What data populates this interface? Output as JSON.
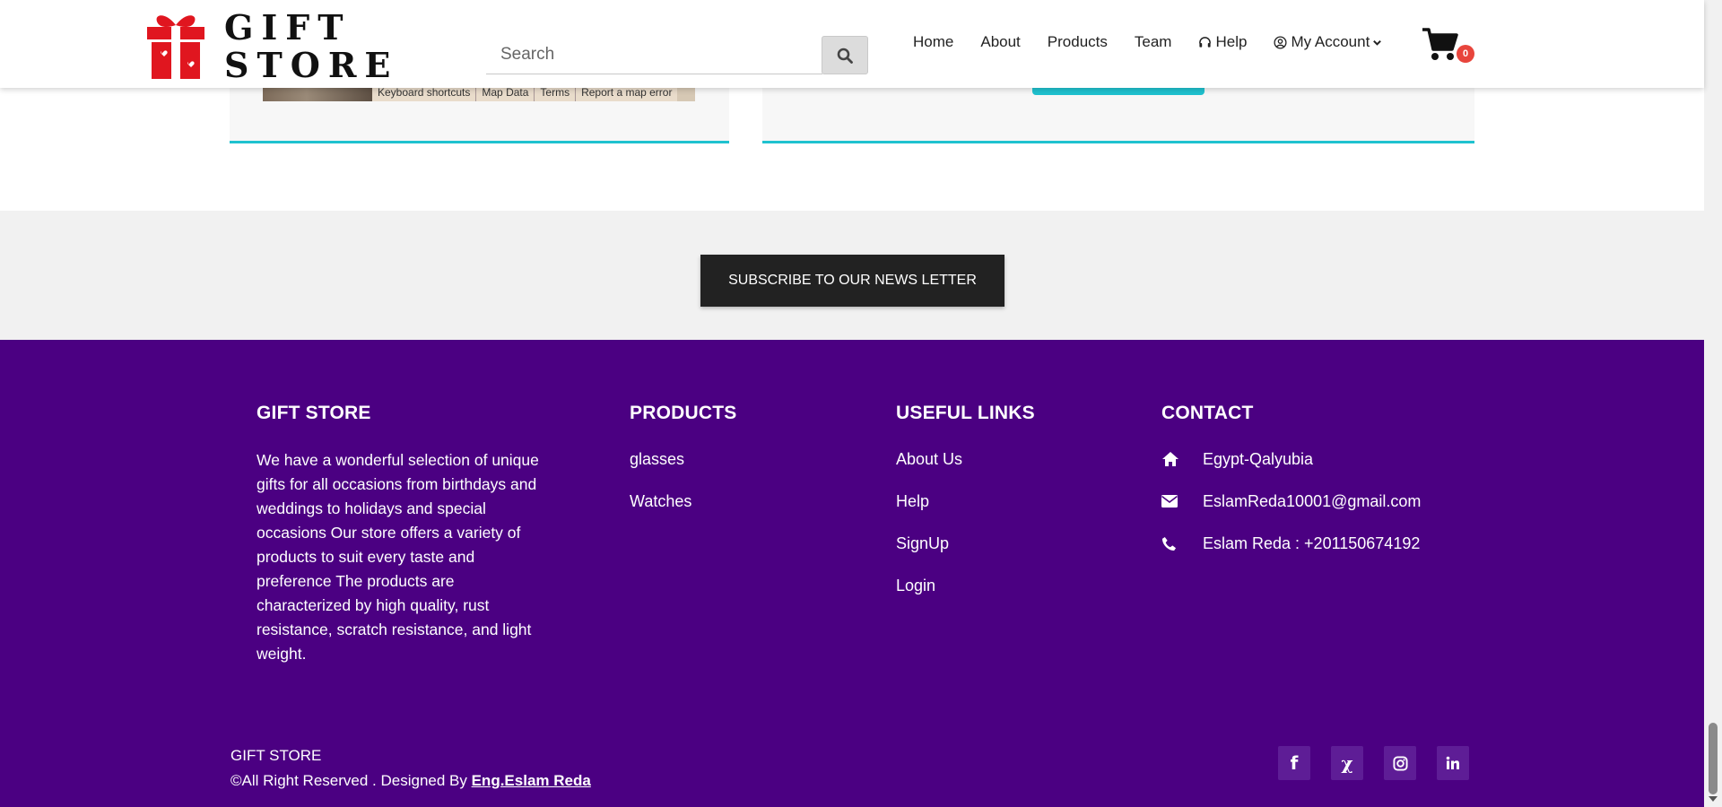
{
  "header": {
    "logo_line1": "GIFT",
    "logo_line2": "STORE",
    "search_placeholder": "Search",
    "nav": [
      "Home",
      "About",
      "Products",
      "Team",
      "Help",
      "My Account"
    ],
    "cart_count": "0"
  },
  "map": {
    "attributions": [
      "Keyboard shortcuts",
      "Map Data",
      "Terms",
      "Report a map error"
    ]
  },
  "newsletter": {
    "button_label": "SUBSCRIBE TO OUR NEWS LETTER"
  },
  "footer": {
    "about": {
      "title": "GIFT STORE",
      "text": "We have a wonderful selection of unique gifts for all occasions from birthdays and weddings to holidays and special occasions Our store offers a variety of products to suit every taste and preference The products are characterized by high quality, rust resistance, scratch resistance, and light weight."
    },
    "products": {
      "title": "PRODUCTS",
      "items": [
        "glasses",
        "Watches"
      ]
    },
    "useful_links": {
      "title": "USEFUL LINKS",
      "items": [
        "About Us",
        "Help",
        "SignUp",
        "Login"
      ]
    },
    "contact": {
      "title": "CONTACT",
      "address": "Egypt-Qalyubia",
      "email": "EslamReda10001@gmail.com",
      "phone": "Eslam Reda : +201150674192"
    },
    "copyright": {
      "brand": "GIFT STORE",
      "text": "©All Right Reserved . Designed By ",
      "designer": "Eng.Eslam Reda"
    },
    "socials": {
      "facebook": "f",
      "x": "χ"
    }
  },
  "colors": {
    "footer_bg": "#4b0082",
    "accent": "#1fc2cf",
    "logo_red": "#e0161f",
    "badge": "#e8453c"
  }
}
